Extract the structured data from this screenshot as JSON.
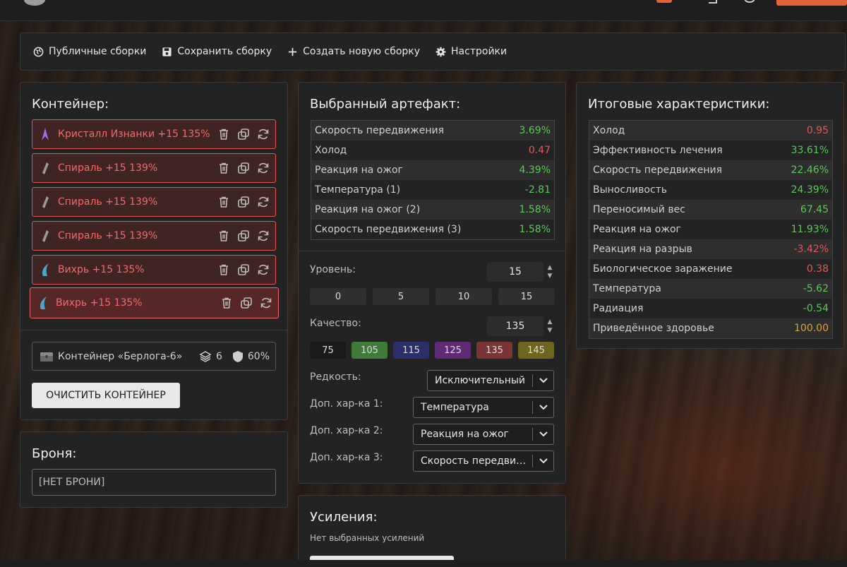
{
  "toolbar": {
    "public_builds": "Публичные сборки",
    "save_build": "Сохранить сборку",
    "new_build": "Создать новую сборку",
    "settings": "Настройки"
  },
  "container": {
    "title": "Контейнер:",
    "artifacts": [
      {
        "name": "Кристалл Изнанки +15 135%",
        "icon": "crystal-icon",
        "color": "#9b6bd6"
      },
      {
        "name": "Спираль +15 139%",
        "icon": "spiral-icon",
        "color": "#9a9a9a"
      },
      {
        "name": "Спираль +15 139%",
        "icon": "spiral-icon",
        "color": "#9a9a9a"
      },
      {
        "name": "Спираль +15 139%",
        "icon": "spiral-icon",
        "color": "#9a9a9a"
      },
      {
        "name": "Вихрь +15 135%",
        "icon": "whirl-icon",
        "color": "#4aa7c9"
      },
      {
        "name": "Вихрь +15 135%",
        "icon": "whirl-icon",
        "color": "#4aa7c9"
      }
    ],
    "box_name": "Контейнер «Берлога-6»",
    "slots": "6",
    "protection": "60%",
    "clear_label": "ОЧИСТИТЬ КОНТЕЙНЕР"
  },
  "armor": {
    "title": "Броня:",
    "value": "[НЕТ БРОНИ]"
  },
  "selected": {
    "title": "Выбранный артефакт:",
    "stats": [
      {
        "name": "Скорость передвижения",
        "value": "3.69%",
        "tone": "pos"
      },
      {
        "name": "Холод",
        "value": "0.47",
        "tone": "neg"
      },
      {
        "name": "Реакция на ожог",
        "value": "4.39%",
        "tone": "pos"
      },
      {
        "name": "Температура (1)",
        "value": "-2.81",
        "tone": "pos"
      },
      {
        "name": "Реакция на ожог (2)",
        "value": "1.58%",
        "tone": "pos"
      },
      {
        "name": "Скорость передвижения (3)",
        "value": "1.58%",
        "tone": "pos"
      }
    ],
    "level_label": "Уровень:",
    "level_value": "15",
    "level_presets": [
      "0",
      "5",
      "10",
      "15"
    ],
    "quality_label": "Качество:",
    "quality_value": "135",
    "quality_presets": [
      "75",
      "105",
      "115",
      "125",
      "135",
      "145"
    ],
    "rarity_label": "Редкость:",
    "rarity_value": "Исключительный",
    "extra1_label": "Доп. хар-ка 1:",
    "extra1_value": "Температура",
    "extra2_label": "Доп. хар-ка 2:",
    "extra2_value": "Реакция на ожог",
    "extra3_label": "Доп. хар-ка 3:",
    "extra3_value": "Скорость передвижения"
  },
  "buffs": {
    "title": "Усиления:",
    "empty": "Нет выбранных усилений"
  },
  "total": {
    "title": "Итоговые характеристики:",
    "stats": [
      {
        "name": "Холод",
        "value": "0.95",
        "tone": "neg"
      },
      {
        "name": "Эффективность лечения",
        "value": "33.61%",
        "tone": "pos"
      },
      {
        "name": "Скорость передвижения",
        "value": "22.46%",
        "tone": "pos"
      },
      {
        "name": "Выносливость",
        "value": "24.39%",
        "tone": "pos"
      },
      {
        "name": "Переносимый вес",
        "value": "67.45",
        "tone": "pos"
      },
      {
        "name": "Реакция на ожог",
        "value": "11.93%",
        "tone": "pos"
      },
      {
        "name": "Реакция на разрыв",
        "value": "-3.42%",
        "tone": "neg"
      },
      {
        "name": "Биологическое заражение",
        "value": "0.38",
        "tone": "neg"
      },
      {
        "name": "Температура",
        "value": "-5.62",
        "tone": "pos"
      },
      {
        "name": "Радиация",
        "value": "-0.54",
        "tone": "pos"
      },
      {
        "name": "Приведённое здоровье",
        "value": "100.00",
        "tone": "gold"
      }
    ]
  }
}
